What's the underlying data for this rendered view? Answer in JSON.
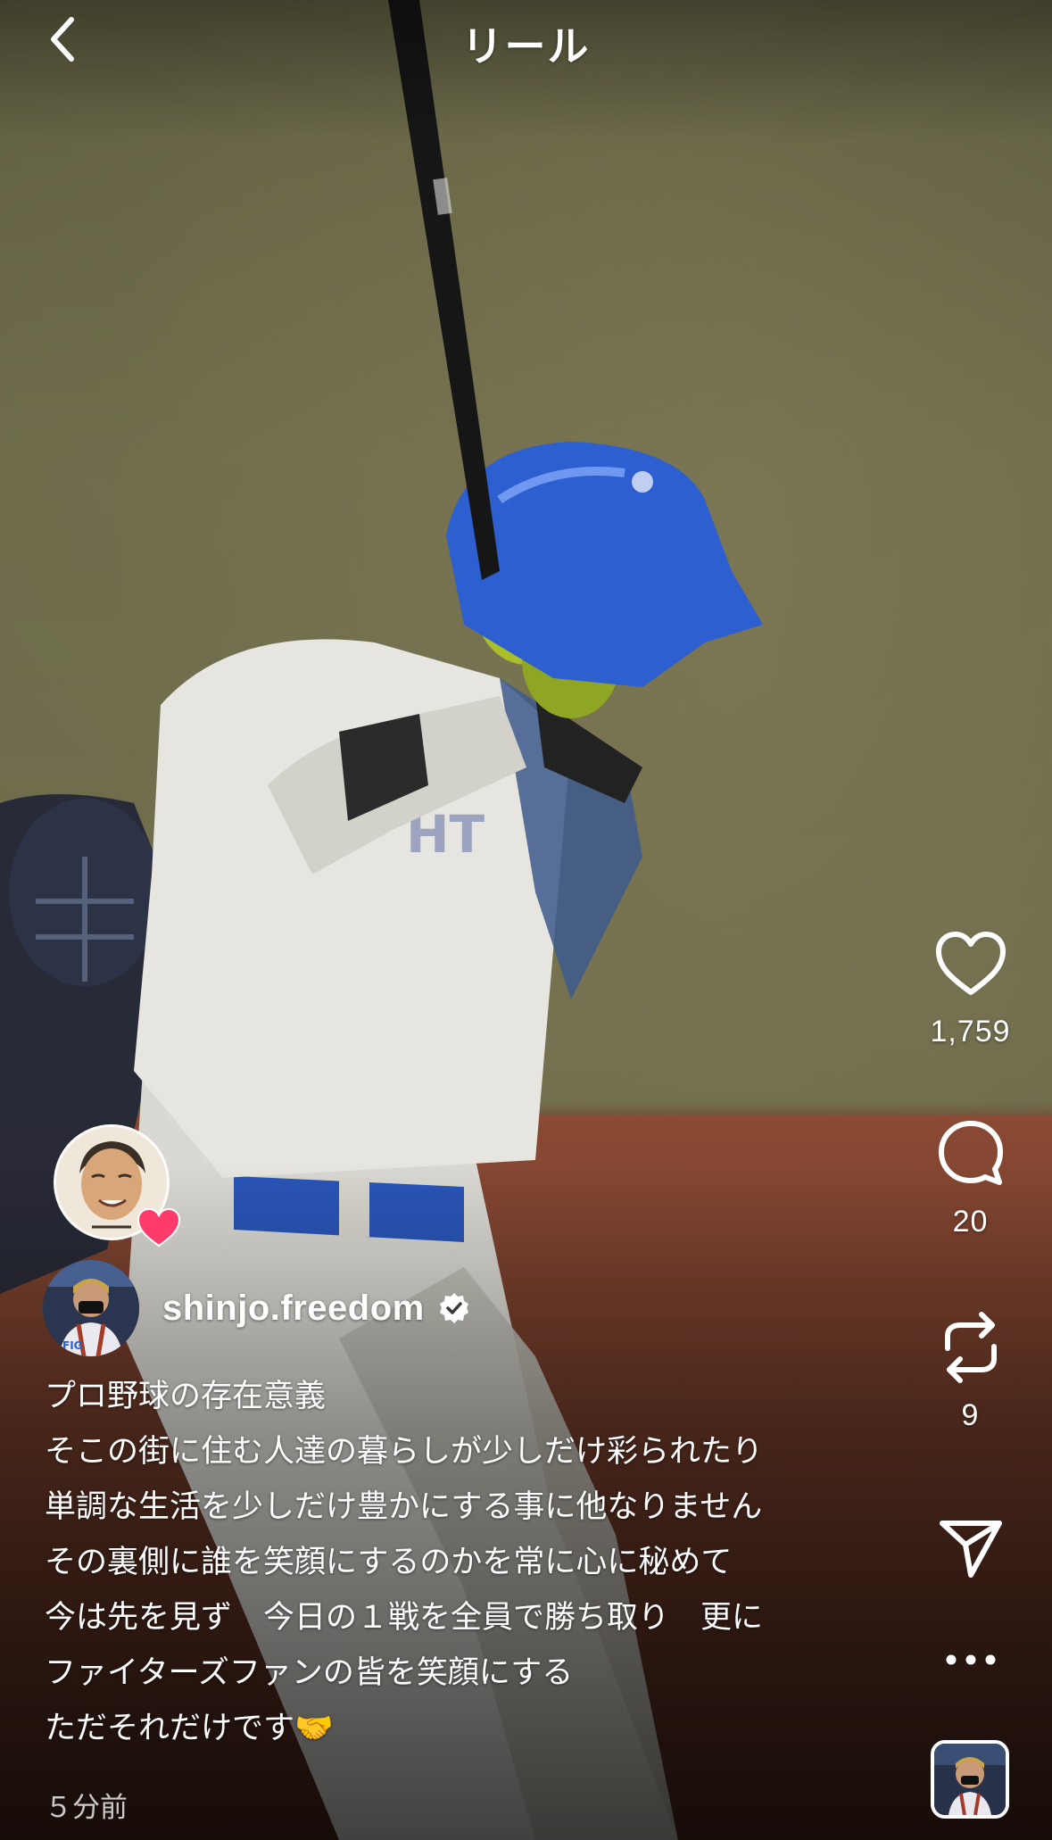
{
  "header": {
    "title": "リール",
    "back_icon": "chevron-left-icon"
  },
  "actions": {
    "like": {
      "icon": "heart-outline-icon",
      "count": "1,759"
    },
    "comment": {
      "icon": "comment-bubble-icon",
      "count": "20"
    },
    "repost": {
      "icon": "repost-arrows-icon",
      "count": "9"
    },
    "share": {
      "icon": "paper-plane-icon"
    },
    "more": {
      "icon": "more-horizontal-icon"
    },
    "audio": {
      "icon": "audio-thumbnail"
    }
  },
  "liker": {
    "avatar": "illustrated-portrait-avatar",
    "badge": "heart-icon",
    "badge_color": "#ff3b6b"
  },
  "author": {
    "username": "shinjo.freedom",
    "verified": true,
    "verified_icon": "verified-badge-icon"
  },
  "caption": {
    "lines": [
      "プロ野球の存在意義",
      "そこの街に住む人達の暮らしが少しだけ彩られたり",
      "単調な生活を少しだけ豊かにする事に他なりません",
      "その裏側に誰を笑顔にするのかを常に心に秘めて",
      "今は先を見ず　今日の１戦を全員で勝ち取り　更に",
      "ファイターズファンの皆を笑顔にする",
      "ただそれだけです"
    ],
    "emoji": "🤝",
    "emoji_icon": "handshake-icon"
  },
  "timestamp": "５分前",
  "colors": {
    "helmet": "#2d5fd0",
    "dirt": "#7a4130",
    "field": "#6b6a4a"
  }
}
